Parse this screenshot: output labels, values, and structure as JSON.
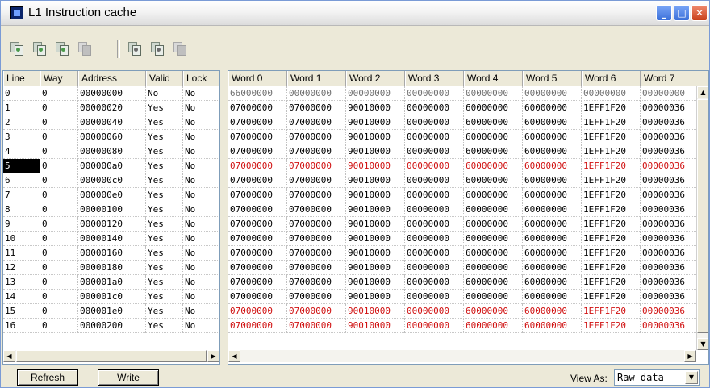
{
  "window": {
    "title": "L1 Instruction cache"
  },
  "toolbar": {
    "icons": [
      "invalidate-all-icon",
      "invalidate-line-icon",
      "refresh-line-icon",
      "lock-icon",
      "save-icon",
      "load-icon",
      "clear-icon"
    ]
  },
  "left_table": {
    "columns": [
      "Line",
      "Way",
      "Address",
      "Valid",
      "Lock"
    ],
    "rows": [
      [
        "0",
        "0",
        "00000000",
        "No",
        "No"
      ],
      [
        "1",
        "0",
        "00000020",
        "Yes",
        "No"
      ],
      [
        "2",
        "0",
        "00000040",
        "Yes",
        "No"
      ],
      [
        "3",
        "0",
        "00000060",
        "Yes",
        "No"
      ],
      [
        "4",
        "0",
        "00000080",
        "Yes",
        "No"
      ],
      [
        "5",
        "0",
        "000000a0",
        "Yes",
        "No"
      ],
      [
        "6",
        "0",
        "000000c0",
        "Yes",
        "No"
      ],
      [
        "7",
        "0",
        "000000e0",
        "Yes",
        "No"
      ],
      [
        "8",
        "0",
        "00000100",
        "Yes",
        "No"
      ],
      [
        "9",
        "0",
        "00000120",
        "Yes",
        "No"
      ],
      [
        "10",
        "0",
        "00000140",
        "Yes",
        "No"
      ],
      [
        "11",
        "0",
        "00000160",
        "Yes",
        "No"
      ],
      [
        "12",
        "0",
        "00000180",
        "Yes",
        "No"
      ],
      [
        "13",
        "0",
        "000001a0",
        "Yes",
        "No"
      ],
      [
        "14",
        "0",
        "000001c0",
        "Yes",
        "No"
      ],
      [
        "15",
        "0",
        "000001e0",
        "Yes",
        "No"
      ],
      [
        "16",
        "0",
        "00000200",
        "Yes",
        "No"
      ]
    ],
    "selected_line": "5"
  },
  "right_table": {
    "columns": [
      "Word 0",
      "Word 1",
      "Word 2",
      "Word 3",
      "Word 4",
      "Word 5",
      "Word 6",
      "Word 7"
    ],
    "rows": [
      [
        "66000000",
        "00000000",
        "00000000",
        "00000000",
        "00000000",
        "00000000",
        "00000000",
        "00000000"
      ],
      [
        "07000000",
        "07000000",
        "90010000",
        "00000000",
        "60000000",
        "60000000",
        "1EFF1F20",
        "00000036"
      ],
      [
        "07000000",
        "07000000",
        "90010000",
        "00000000",
        "60000000",
        "60000000",
        "1EFF1F20",
        "00000036"
      ],
      [
        "07000000",
        "07000000",
        "90010000",
        "00000000",
        "60000000",
        "60000000",
        "1EFF1F20",
        "00000036"
      ],
      [
        "07000000",
        "07000000",
        "90010000",
        "00000000",
        "60000000",
        "60000000",
        "1EFF1F20",
        "00000036"
      ],
      [
        "07000000",
        "07000000",
        "90010000",
        "00000000",
        "60000000",
        "60000000",
        "1EFF1F20",
        "00000036"
      ],
      [
        "07000000",
        "07000000",
        "90010000",
        "00000000",
        "60000000",
        "60000000",
        "1EFF1F20",
        "00000036"
      ],
      [
        "07000000",
        "07000000",
        "90010000",
        "00000000",
        "60000000",
        "60000000",
        "1EFF1F20",
        "00000036"
      ],
      [
        "07000000",
        "07000000",
        "90010000",
        "00000000",
        "60000000",
        "60000000",
        "1EFF1F20",
        "00000036"
      ],
      [
        "07000000",
        "07000000",
        "90010000",
        "00000000",
        "60000000",
        "60000000",
        "1EFF1F20",
        "00000036"
      ],
      [
        "07000000",
        "07000000",
        "90010000",
        "00000000",
        "60000000",
        "60000000",
        "1EFF1F20",
        "00000036"
      ],
      [
        "07000000",
        "07000000",
        "90010000",
        "00000000",
        "60000000",
        "60000000",
        "1EFF1F20",
        "00000036"
      ],
      [
        "07000000",
        "07000000",
        "90010000",
        "00000000",
        "60000000",
        "60000000",
        "1EFF1F20",
        "00000036"
      ],
      [
        "07000000",
        "07000000",
        "90010000",
        "00000000",
        "60000000",
        "60000000",
        "1EFF1F20",
        "00000036"
      ],
      [
        "07000000",
        "07000000",
        "90010000",
        "00000000",
        "60000000",
        "60000000",
        "1EFF1F20",
        "00000036"
      ],
      [
        "07000000",
        "07000000",
        "90010000",
        "00000000",
        "60000000",
        "60000000",
        "1EFF1F20",
        "00000036"
      ],
      [
        "07000000",
        "07000000",
        "90010000",
        "00000000",
        "60000000",
        "60000000",
        "1EFF1F20",
        "00000036"
      ]
    ],
    "row_styles": [
      "gray",
      "normal",
      "normal",
      "normal",
      "normal",
      "red",
      "normal",
      "normal",
      "normal",
      "normal",
      "normal",
      "normal",
      "normal",
      "normal",
      "normal",
      "red",
      "red"
    ]
  },
  "bottom": {
    "refresh_label": "Refresh",
    "write_label": "Write",
    "view_as_label": "View As:",
    "view_as_value": "Raw data"
  },
  "colors": {
    "changed_row": "#d01010",
    "invalid_row": "#707070",
    "selection": "#000000"
  }
}
